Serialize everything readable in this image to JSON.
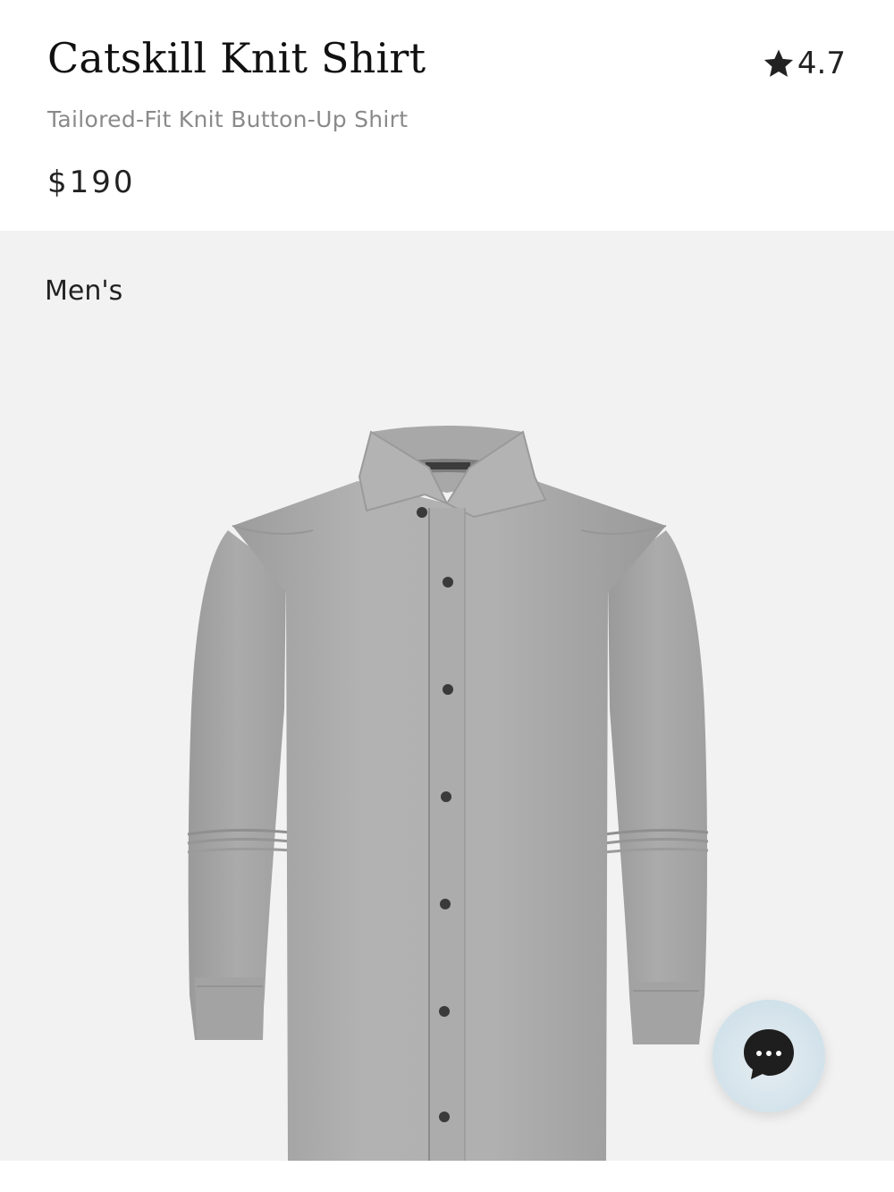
{
  "product": {
    "name": "Catskill Knit Shirt",
    "subtitle": "Tailored-Fit Knit Button-Up Shirt",
    "price": "$190",
    "rating": "4.7",
    "category_label": "Men's",
    "image_icon": "shirt-image"
  },
  "chat": {
    "icon": "chat-bubble-icon"
  },
  "colors": {
    "panel_background": "#f2f2f2",
    "shirt_gray": "#a9a9a9",
    "chat_bubble": "#1e1e1e",
    "chat_button_bg": "#d4e3eb"
  }
}
